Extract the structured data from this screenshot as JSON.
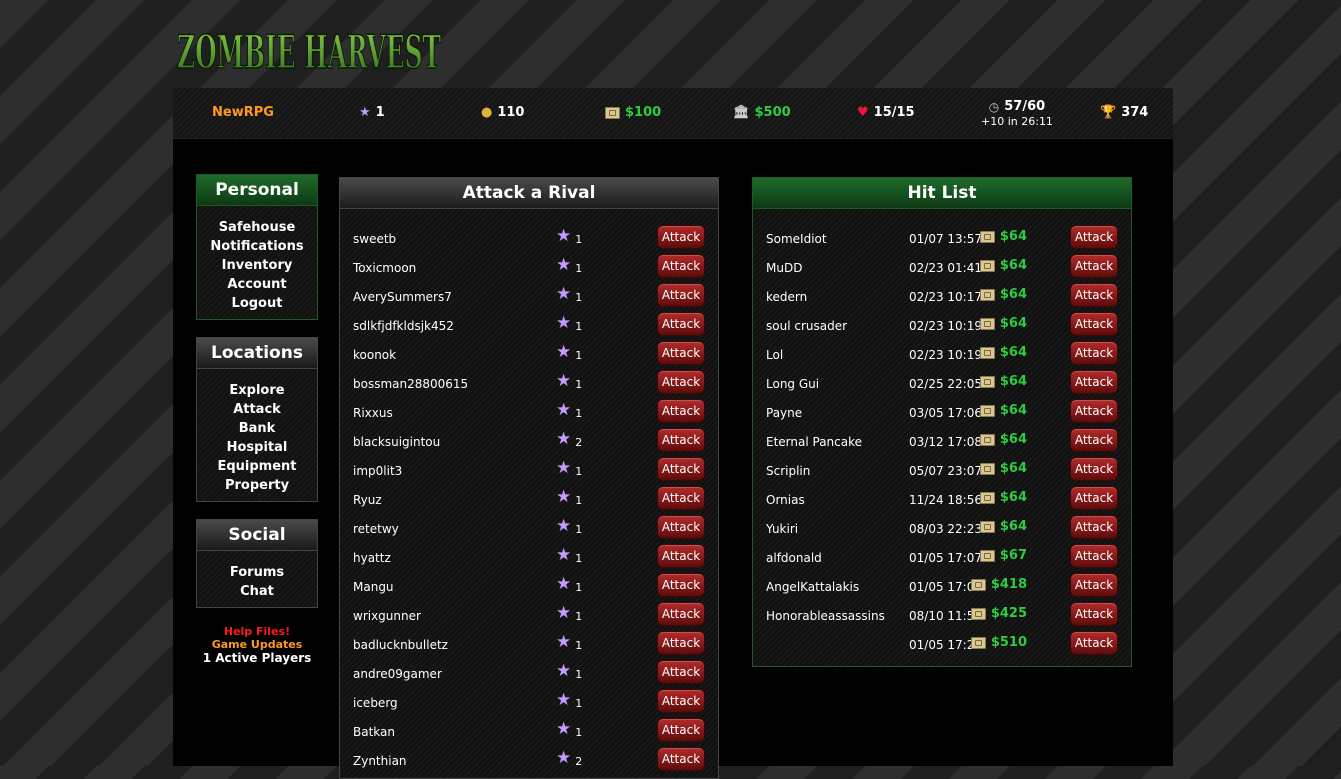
{
  "brand": {
    "logo_text": "ZOMBIE HARVEST"
  },
  "status": {
    "username": "NewRPG",
    "level": "1",
    "points": "110",
    "cash": "$100",
    "bank": "$500",
    "health": "15/15",
    "energy": "57/60",
    "energy_regen": "+10 in 26:11",
    "trophies": "374",
    "icons": {
      "level": "star-icon",
      "points": "coin-icon",
      "cash": "cash-icon",
      "bank": "bank-icon",
      "health": "heart-icon",
      "energy": "clock-icon",
      "trophies": "trophy-icon"
    }
  },
  "sidebar": {
    "personal": {
      "title": "Personal",
      "items": [
        "Safehouse",
        "Notifications",
        "Inventory",
        "Account",
        "Logout"
      ]
    },
    "locations": {
      "title": "Locations",
      "items": [
        "Explore",
        "Attack",
        "Bank",
        "Hospital",
        "Equipment",
        "Property"
      ]
    },
    "social": {
      "title": "Social",
      "items": [
        "Forums",
        "Chat"
      ]
    },
    "help_link": "Help Files!",
    "updates_link": "Game Updates",
    "active_players": "1 Active Players"
  },
  "rival": {
    "title": "Attack a Rival",
    "attack_label": "Attack",
    "rows": [
      {
        "name": "sweetb",
        "level": "1"
      },
      {
        "name": "Toxicmoon",
        "level": "1"
      },
      {
        "name": "AverySummers7",
        "level": "1"
      },
      {
        "name": "sdlkfjdfkldsjk452",
        "level": "1"
      },
      {
        "name": "koonok",
        "level": "1"
      },
      {
        "name": "bossman28800615",
        "level": "1"
      },
      {
        "name": "Rixxus",
        "level": "1"
      },
      {
        "name": "blacksuigintou",
        "level": "2"
      },
      {
        "name": "imp0lit3",
        "level": "1"
      },
      {
        "name": "Ryuz",
        "level": "1"
      },
      {
        "name": "retetwy",
        "level": "1"
      },
      {
        "name": "hyattz",
        "level": "1"
      },
      {
        "name": "Mangu",
        "level": "1"
      },
      {
        "name": "wrixgunner",
        "level": "1"
      },
      {
        "name": "badlucknbulletz",
        "level": "1"
      },
      {
        "name": "andre09gamer",
        "level": "1"
      },
      {
        "name": "iceberg",
        "level": "1"
      },
      {
        "name": "Batkan",
        "level": "1"
      },
      {
        "name": "Zynthian",
        "level": "2"
      }
    ]
  },
  "hitlist": {
    "title": "Hit List",
    "attack_label": "Attack",
    "rows": [
      {
        "name": "SomeIdiot",
        "date": "01/07 13:57",
        "bounty": "$64"
      },
      {
        "name": "MuDD",
        "date": "02/23 01:41",
        "bounty": "$64"
      },
      {
        "name": "kedern",
        "date": "02/23 10:17",
        "bounty": "$64"
      },
      {
        "name": "soul crusader",
        "date": "02/23 10:19",
        "bounty": "$64"
      },
      {
        "name": "Lol",
        "date": "02/23 10:19",
        "bounty": "$64"
      },
      {
        "name": "Long Gui",
        "date": "02/25 22:05",
        "bounty": "$64"
      },
      {
        "name": "Payne",
        "date": "03/05 17:06",
        "bounty": "$64"
      },
      {
        "name": "Eternal Pancake",
        "date": "03/12 17:08",
        "bounty": "$64"
      },
      {
        "name": "Scriplin",
        "date": "05/07 23:07",
        "bounty": "$64"
      },
      {
        "name": "Ornias",
        "date": "11/24 18:56",
        "bounty": "$64"
      },
      {
        "name": "Yukiri",
        "date": "08/03 22:23",
        "bounty": "$64"
      },
      {
        "name": "alfdonald",
        "date": "01/05 17:07",
        "bounty": "$67"
      },
      {
        "name": "AngelKattalakis",
        "date": "01/05 17:02",
        "bounty": "$418"
      },
      {
        "name": "Honorableassassins",
        "date": "08/10 11:55",
        "bounty": "$425"
      },
      {
        "name": "",
        "date": "01/05 17:23",
        "bounty": "$510"
      }
    ]
  },
  "colors": {
    "accent_green": "#2ecc40",
    "username_orange": "#ff9a1f",
    "help_red": "#ff1a1a",
    "attack_button": "#8a1a1a"
  }
}
